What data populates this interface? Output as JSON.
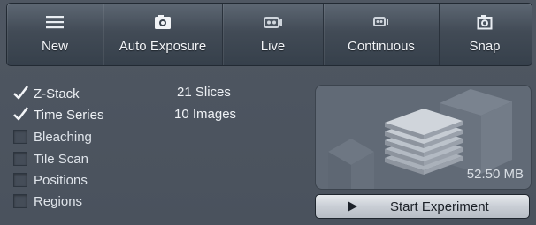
{
  "toolbar": {
    "buttons": [
      {
        "label": "New",
        "icon": "list-icon"
      },
      {
        "label": "Auto Exposure",
        "icon": "camera-icon"
      },
      {
        "label": "Live",
        "icon": "live-camera-icon"
      },
      {
        "label": "Continuous",
        "icon": "continuous-camera-icon"
      },
      {
        "label": "Snap",
        "icon": "snap-icon"
      }
    ]
  },
  "options": [
    {
      "label": "Z-Stack",
      "checked": true,
      "value": "21 Slices"
    },
    {
      "label": "Time Series",
      "checked": true,
      "value": "10 Images"
    },
    {
      "label": "Bleaching",
      "checked": false
    },
    {
      "label": "Tile Scan",
      "checked": false
    },
    {
      "label": "Positions",
      "checked": false
    },
    {
      "label": "Regions",
      "checked": false
    }
  ],
  "preview": {
    "size": "52.50 MB"
  },
  "start_button": {
    "label": "Start Experiment"
  },
  "colors": {
    "panel": "#4d5560",
    "toolbar": "#424b56",
    "button_light": "#d4d8de"
  }
}
